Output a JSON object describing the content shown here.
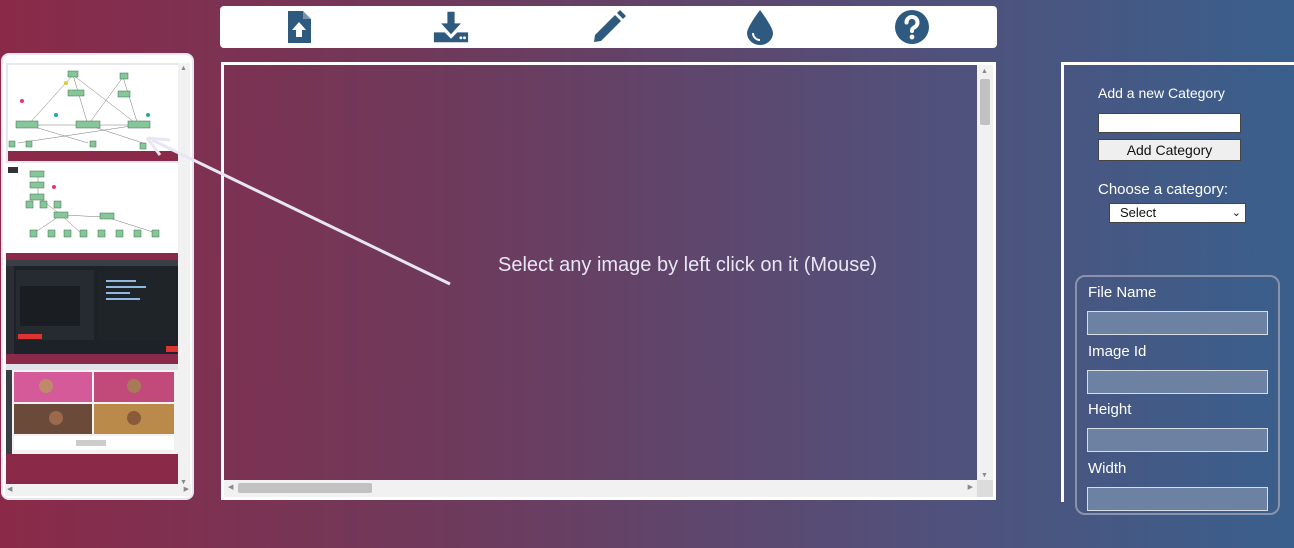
{
  "toolbar": {
    "items": [
      {
        "name": "upload",
        "icon": "file-upload-icon"
      },
      {
        "name": "download",
        "icon": "download-icon"
      },
      {
        "name": "edit",
        "icon": "pencil-icon"
      },
      {
        "name": "color",
        "icon": "water-drop-icon"
      },
      {
        "name": "help",
        "icon": "question-circle-icon"
      }
    ],
    "icon_color": "#2f5a80"
  },
  "thumbnails": [
    {
      "name": "thumbnail-1",
      "description_icon": "diagram-thumbnail",
      "selected": true
    },
    {
      "name": "thumbnail-2",
      "description_icon": "diagram-thumbnail",
      "selected": false
    },
    {
      "name": "thumbnail-3",
      "description_icon": "screenshot-thumbnail",
      "selected": false
    },
    {
      "name": "thumbnail-4",
      "description_icon": "video-call-thumbnail",
      "selected": false
    }
  ],
  "canvas": {
    "hint": "Select any image by left click on it (Mouse)"
  },
  "category": {
    "add_label": "Add a new Category",
    "input_value": "",
    "add_button": "Add Category",
    "choose_label": "Choose a category:",
    "select_value": "Select"
  },
  "info": {
    "file_name_label": "File Name",
    "file_name_value": "",
    "image_id_label": "Image Id",
    "image_id_value": "",
    "height_label": "Height",
    "height_value": "",
    "width_label": "Width",
    "width_value": ""
  },
  "colors": {
    "gradient_left": "#8a2a48",
    "gradient_right": "#3a5f8c",
    "hint_text": "#e9e6f4"
  }
}
